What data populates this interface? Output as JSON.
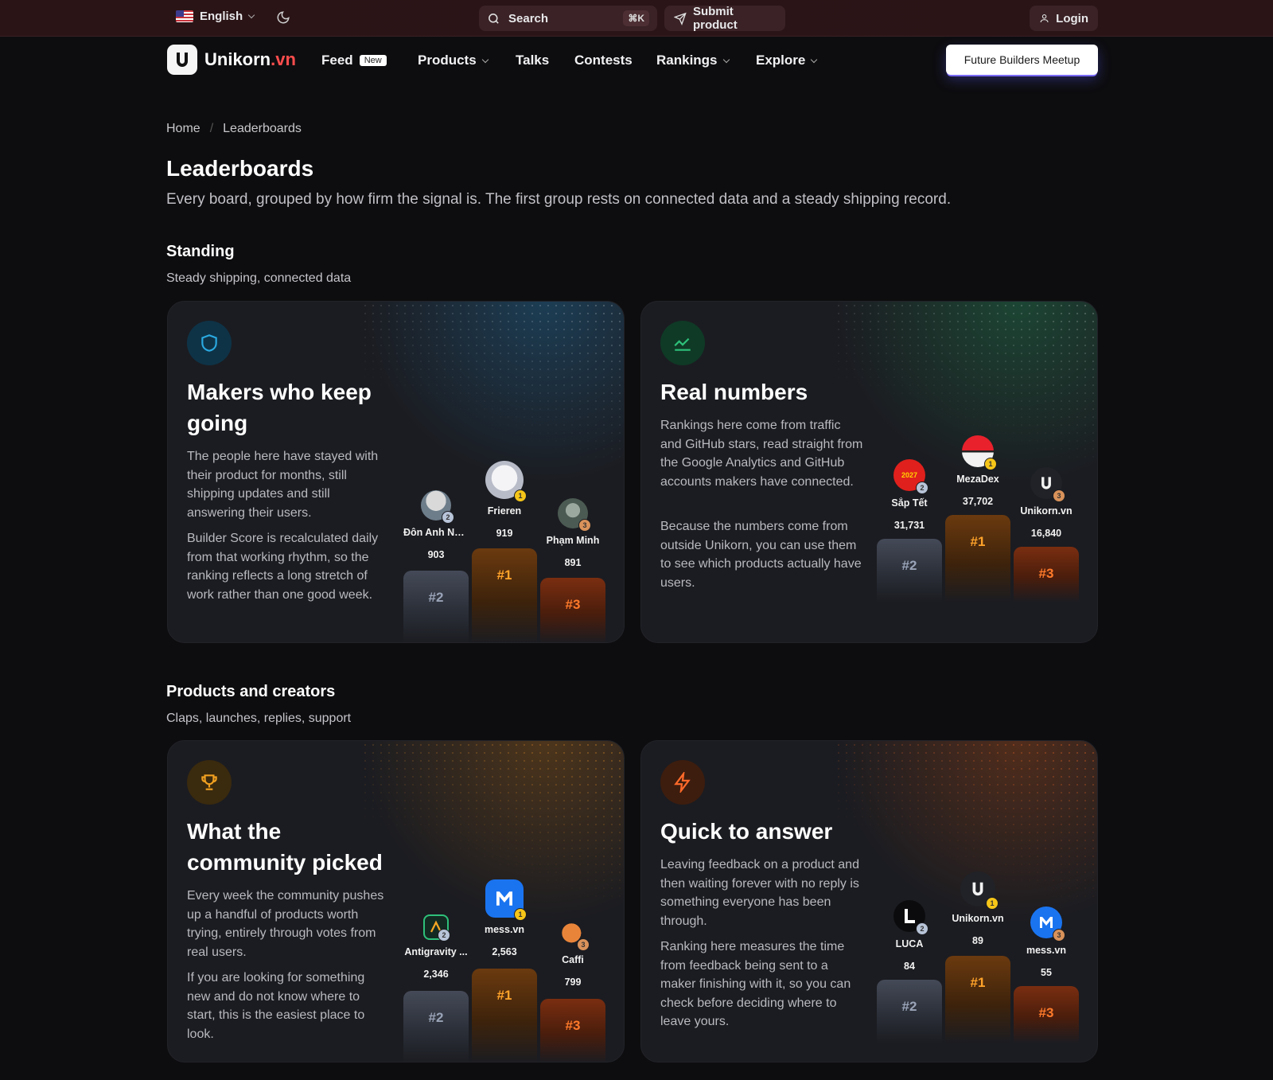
{
  "topbar": {
    "language": "English",
    "search_label": "Search",
    "search_shortcut": "⌘K",
    "submit_label": "Submit product",
    "login_label": "Login"
  },
  "nav": {
    "logo_name": "Unikorn",
    "logo_tld": ".vn",
    "feed": "Feed",
    "feed_badge": "New",
    "products": "Products",
    "talks": "Talks",
    "contests": "Contests",
    "rankings": "Rankings",
    "explore": "Explore",
    "cta": "Future Builders Meetup"
  },
  "breadcrumb": {
    "home": "Home",
    "current": "Leaderboards"
  },
  "page": {
    "title": "Leaderboards",
    "subtitle": "Every board, grouped by how firm the signal is. The first group rests on connected data and a steady shipping record."
  },
  "sections": [
    {
      "title": "Standing",
      "subtitle": "Steady shipping, connected data",
      "cards": [
        {
          "icon": "shield-icon",
          "accent": "#2aa9e0",
          "title": "Makers who keep going",
          "paragraphs": [
            "The people here have stayed with their product for months, still shipping updates and still answering their users.",
            "Builder Score is recalculated daily from that working rhythm, so the ranking reflects a long stretch of work rather than one good week."
          ],
          "podium": {
            "first": {
              "name": "Frieren",
              "score": "919",
              "rank": "#1"
            },
            "second": {
              "name": "Đôn Anh Ng...",
              "score": "903",
              "rank": "#2"
            },
            "third": {
              "name": "Phạm Minh",
              "score": "891",
              "rank": "#3"
            }
          }
        },
        {
          "icon": "trend-icon",
          "accent": "#2ec07a",
          "title": "Real numbers",
          "paragraphs": [
            "Rankings here come from traffic and GitHub stars, read straight from the Google Analytics and GitHub accounts makers have connected.",
            "Because the numbers come from outside Unikorn, you can use them to see which products actually have users."
          ],
          "podium": {
            "first": {
              "name": "MezaDex",
              "score": "37,702",
              "rank": "#1"
            },
            "second": {
              "name": "Sắp Tết",
              "score": "31,731",
              "rank": "#2"
            },
            "third": {
              "name": "Unikorn.vn",
              "score": "16,840",
              "rank": "#3"
            }
          }
        }
      ]
    },
    {
      "title": "Products and creators",
      "subtitle": "Claps, launches, replies, support",
      "cards": [
        {
          "icon": "trophy-icon",
          "accent": "#f0a020",
          "title": "What the community picked",
          "paragraphs": [
            "Every week the community pushes up a handful of products worth trying, entirely through votes from real users.",
            "If you are looking for something new and do not know where to start, this is the easiest place to look."
          ],
          "podium": {
            "first": {
              "name": "mess.vn",
              "score": "2,563",
              "rank": "#1"
            },
            "second": {
              "name": "Antigravity ...",
              "score": "2,346",
              "rank": "#2"
            },
            "third": {
              "name": "Caffi",
              "score": "799",
              "rank": "#3"
            }
          }
        },
        {
          "icon": "bolt-icon",
          "accent": "#ff6a2a",
          "title": "Quick to answer",
          "paragraphs": [
            "Leaving feedback on a product and then waiting forever with no reply is something everyone has been through.",
            "Ranking here measures the time from feedback being sent to a maker finishing with it, so you can check before deciding where to leave yours."
          ],
          "podium": {
            "first": {
              "name": "Unikorn.vn",
              "score": "89",
              "rank": "#1"
            },
            "second": {
              "name": "LUCA",
              "score": "84",
              "rank": "#2"
            },
            "third": {
              "name": "mess.vn",
              "score": "55",
              "rank": "#3"
            }
          }
        }
      ]
    }
  ],
  "badges": {
    "one": "1",
    "two": "2",
    "three": "3"
  },
  "avatar_marks": {
    "sap_tet": "2027"
  }
}
